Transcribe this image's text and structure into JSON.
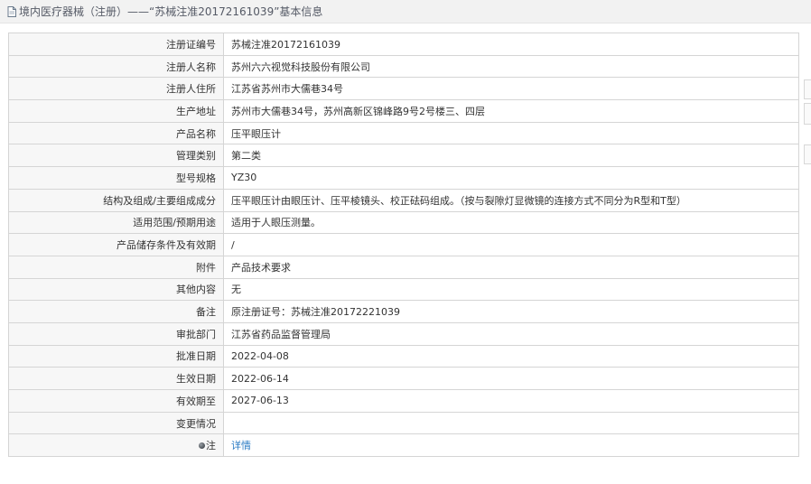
{
  "header": {
    "title": "境内医疗器械（注册）——“苏械注准20172161039”基本信息",
    "icon": "document-icon"
  },
  "rows": [
    {
      "label": "注册证编号",
      "value": "苏械注准20172161039"
    },
    {
      "label": "注册人名称",
      "value": "苏州六六视觉科技股份有限公司"
    },
    {
      "label": "注册人住所",
      "value": "江苏省苏州市大儒巷34号"
    },
    {
      "label": "生产地址",
      "value": "苏州市大儒巷34号，苏州高新区锦峰路9号2号楼三、四层"
    },
    {
      "label": "产品名称",
      "value": "压平眼压计"
    },
    {
      "label": "管理类别",
      "value": "第二类"
    },
    {
      "label": "型号规格",
      "value": "YZ30"
    },
    {
      "label": "结构及组成/主要组成成分",
      "value": "压平眼压计由眼压计、压平棱镜头、校正砝码组成。（按与裂隙灯显微镜的连接方式不同分为R型和T型）"
    },
    {
      "label": "适用范围/预期用途",
      "value": "适用于人眼压测量。"
    },
    {
      "label": "产品储存条件及有效期",
      "value": "/"
    },
    {
      "label": "附件",
      "value": "产品技术要求"
    },
    {
      "label": "其他内容",
      "value": "无"
    },
    {
      "label": "备注",
      "value": "原注册证号：苏械注准20172221039"
    },
    {
      "label": "审批部门",
      "value": "江苏省药品监督管理局"
    },
    {
      "label": "批准日期",
      "value": "2022-04-08"
    },
    {
      "label": "生效日期",
      "value": "2022-06-14"
    },
    {
      "label": "有效期至",
      "value": "2027-06-13"
    },
    {
      "label": "变更情况",
      "value": ""
    },
    {
      "label": "注",
      "value": "详情"
    }
  ],
  "colors": {
    "link": "#2a7bc4",
    "label_bg": "#f7f7f7",
    "border": "#d5d5d5"
  }
}
